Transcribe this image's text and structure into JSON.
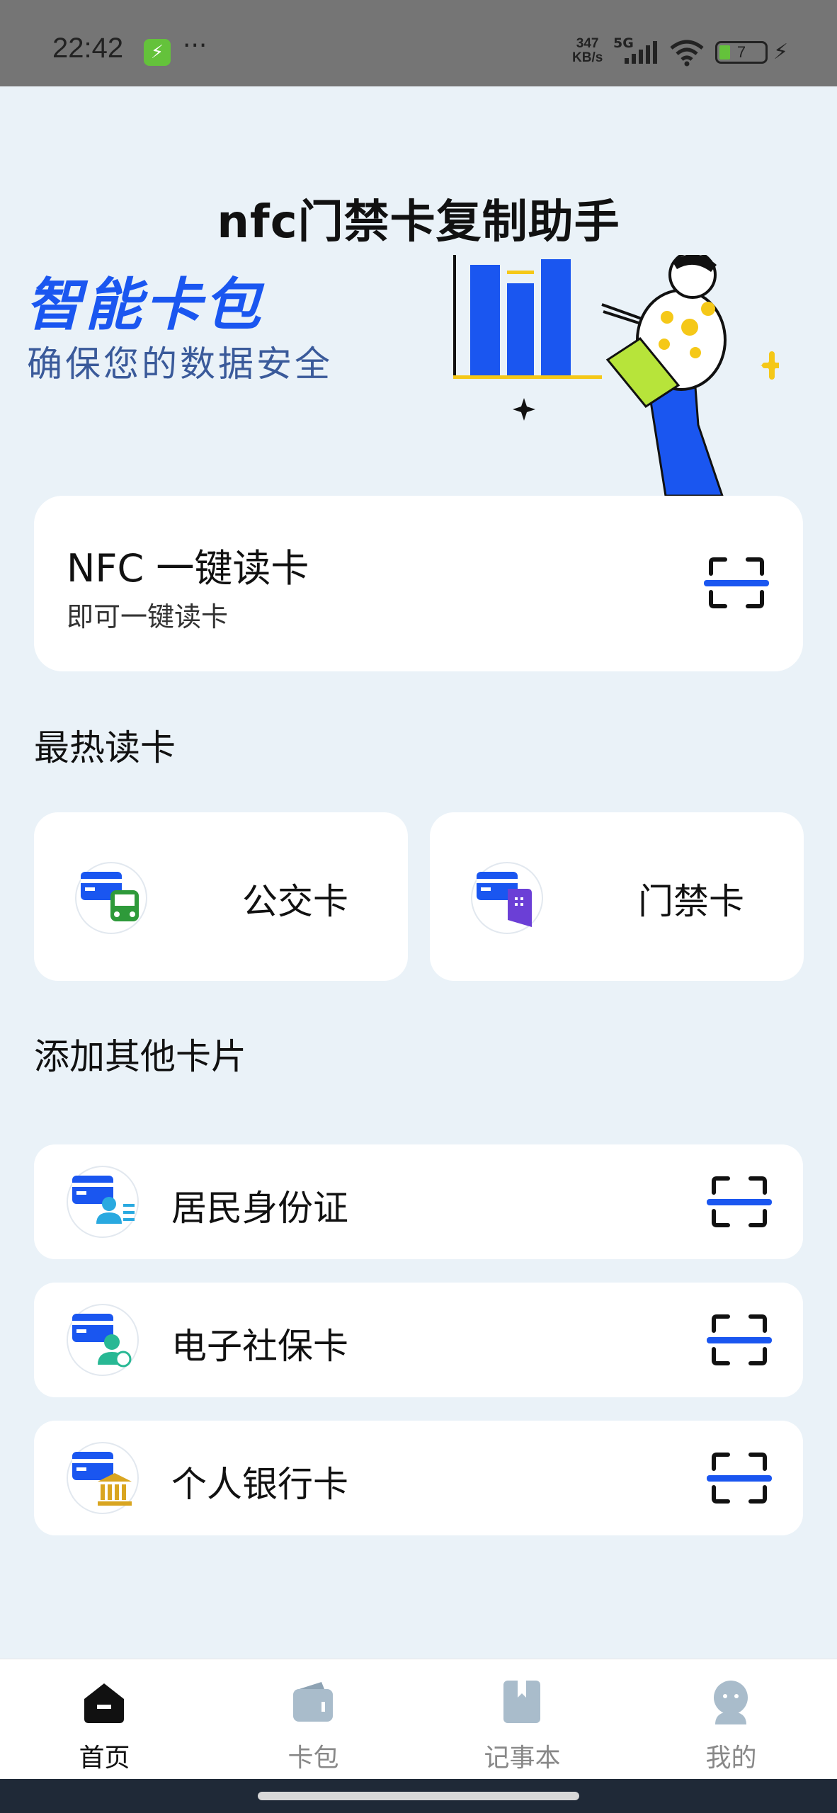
{
  "status_bar": {
    "time": "22:42",
    "dots": "···",
    "speed_value": "347",
    "speed_unit": "KB/s",
    "network": "5G",
    "battery": "7",
    "battery_level": 0.07
  },
  "header": {
    "title": "nfc门禁卡复制助手"
  },
  "banner": {
    "title": "智能卡包",
    "subtitle": "确保您的数据安全"
  },
  "nfc_card": {
    "title": "NFC 一键读卡",
    "subtitle": "即可一键读卡"
  },
  "hot_section": {
    "title": "最热读卡",
    "items": [
      {
        "label": "公交卡",
        "icon": "bus-card-icon"
      },
      {
        "label": "门禁卡",
        "icon": "access-card-icon"
      }
    ]
  },
  "other_section": {
    "title": "添加其他卡片",
    "items": [
      {
        "label": "居民身份证",
        "icon": "id-card-icon"
      },
      {
        "label": "电子社保卡",
        "icon": "social-security-card-icon"
      },
      {
        "label": "个人银行卡",
        "icon": "bank-card-icon"
      }
    ]
  },
  "tabs": [
    {
      "label": "首页",
      "icon": "home-icon",
      "active": true
    },
    {
      "label": "卡包",
      "icon": "wallet-icon",
      "active": false
    },
    {
      "label": "记事本",
      "icon": "notebook-icon",
      "active": false
    },
    {
      "label": "我的",
      "icon": "profile-icon",
      "active": false
    }
  ],
  "colors": {
    "accent": "#1a56f0",
    "background": "#eaf2f8",
    "card": "#ffffff",
    "illustration_green": "#b7e43a",
    "illustration_yellow": "#f5c818"
  }
}
